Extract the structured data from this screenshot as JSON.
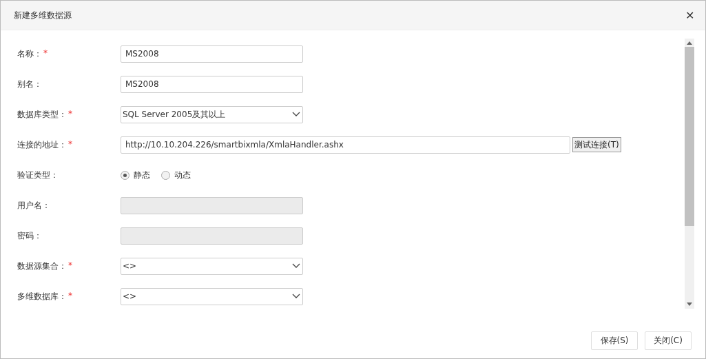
{
  "window": {
    "title": "新建多维数据源",
    "close": "✕"
  },
  "fields": [
    {
      "label": "名称：",
      "mark": "*",
      "kind": "text",
      "value": "MS2008",
      "disabled": false
    },
    {
      "label": "别名：",
      "kind": "text",
      "value": "MS2008",
      "disabled": false
    },
    {
      "label": "数据库类型：",
      "mark": "*",
      "kind": "select",
      "value": "SQL Server 2005及其以上"
    },
    {
      "label": "连接的地址：",
      "mark": "*",
      "kind": "url",
      "value": "http://10.10.204.226/smartbixmla/XmlaHandler.ashx",
      "button": "测试连接(T)"
    },
    {
      "label": "验证类型：",
      "kind": "radio",
      "options": [
        {
          "label": "静态",
          "selected": true
        },
        {
          "label": "动态",
          "selected": false
        }
      ]
    },
    {
      "label": "用户名：",
      "kind": "text",
      "disabled": true
    },
    {
      "label": "密码：",
      "kind": "text",
      "disabled": true
    },
    {
      "label": "数据源集合：",
      "mark": "*",
      "kind": "select",
      "value": "<>"
    },
    {
      "label": "多维数据库：",
      "mark": "*",
      "kind": "select",
      "value": "<>"
    }
  ],
  "buttons": [
    "保存(S)",
    "关闭(C)"
  ]
}
